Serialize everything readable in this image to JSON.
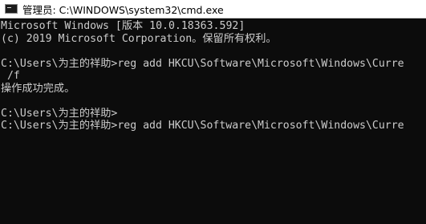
{
  "window": {
    "title": "管理员: C:\\WINDOWS\\system32\\cmd.exe",
    "icon": "cmd-icon"
  },
  "console": {
    "lines": [
      "Microsoft Windows [版本 10.0.18363.592]",
      "(c) 2019 Microsoft Corporation。保留所有权利。",
      "",
      "C:\\Users\\为主的祥助>reg add HKCU\\Software\\Microsoft\\Windows\\Curre",
      " /f",
      "操作成功完成。",
      "",
      "C:\\Users\\为主的祥助>",
      "C:\\Users\\为主的祥助>reg add HKCU\\Software\\Microsoft\\Windows\\Curre"
    ]
  },
  "colors": {
    "background": "#0c0c0c",
    "text": "#cccccc",
    "titlebar": "#ffffff"
  }
}
